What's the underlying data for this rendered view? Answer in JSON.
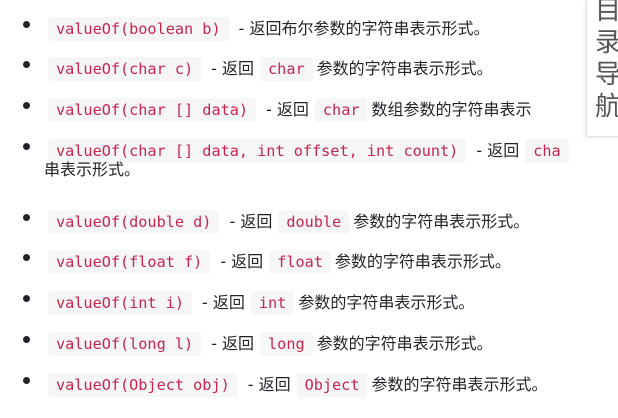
{
  "items": [
    {
      "code": "valueOf(boolean b)",
      "desc": "- 返回布尔参数的字符串表示形式。"
    },
    {
      "code": "valueOf(char c)",
      "pre": "- 返回",
      "type": "char",
      "post": "参数的字符串表示形式。"
    },
    {
      "code": "valueOf(char [] data)",
      "pre": "- 返回",
      "type": "char",
      "post": "数组参数的字符串表示"
    },
    {
      "code": "valueOf(char [] data, int offset, int count)",
      "pre": "- 返回",
      "type": "cha",
      "wrap": "串表示形式。"
    },
    {
      "code": "valueOf(double d)",
      "pre": "- 返回",
      "type": "double",
      "post": "参数的字符串表示形式。"
    },
    {
      "code": "valueOf(float f)",
      "pre": "- 返回",
      "type": "float",
      "post": "参数的字符串表示形式。"
    },
    {
      "code": "valueOf(int i)",
      "pre": "- 返回",
      "type": "int",
      "post": "参数的字符串表示形式。"
    },
    {
      "code": "valueOf(long l)",
      "pre": "- 返回",
      "type": "long",
      "post": "参数的字符串表示形式。"
    },
    {
      "code": "valueOf(Object obj)",
      "pre": "- 返回",
      "type": "Object",
      "post": "参数的字符串表示形式。"
    }
  ],
  "toc": {
    "chars": [
      "目",
      "录",
      "导",
      "航"
    ]
  }
}
